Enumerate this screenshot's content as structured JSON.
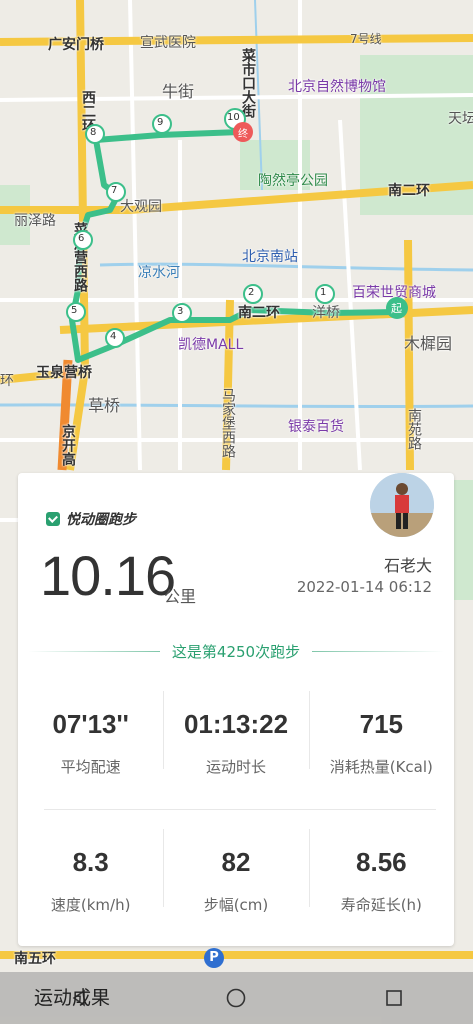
{
  "map": {
    "labels": {
      "guanganmen_bridge": "广安门桥",
      "xuanwu_hospital": "宣武医院",
      "line7": "7号线",
      "niujie": "牛街",
      "caishikou": "菜市口大街",
      "natural_museum": "北京自然博物馆",
      "tiantan": "天坛",
      "xierhuan": "西二环",
      "taoranting": "陶然亭公园",
      "nanerhuan": "南二环",
      "lizelu": "丽泽路",
      "daguanyuan": "大观园",
      "beijing_south": "北京南站",
      "liangshuihe": "凉水河",
      "bairong": "百荣世贸商城",
      "muxiyuan": "木樨园",
      "caihu_road": "菜户营西路",
      "kaide": "凯德MALL",
      "erhuan_road_label": "南二环",
      "yangqiao": "洋桥",
      "yuquanying": "玉泉营桥",
      "caoqiao": "草桥",
      "majiabao": "马家堡西路",
      "yintai": "银泰百货",
      "nanyuan": "南苑路",
      "jingkai": "京开高",
      "nanwuhuan": "南五环",
      "start": "起",
      "end": "终",
      "huan_left": "环"
    },
    "markers": [
      "1",
      "2",
      "3",
      "4",
      "5",
      "6",
      "7",
      "8",
      "9",
      "10"
    ],
    "route_color": "#3cbf8a"
  },
  "card": {
    "app_name": "悦动圈跑步",
    "distance": "10.16",
    "distance_unit": "公里",
    "user_name": "石老大",
    "datetime": "2022-01-14 06:12",
    "run_count_text": "这是第4250次跑步",
    "stats_row1": [
      {
        "value": "07'13''",
        "label": "平均配速"
      },
      {
        "value": "01:13:22",
        "label": "运动时长"
      },
      {
        "value": "715",
        "label": "消耗热量(Kcal)"
      }
    ],
    "stats_row2": [
      {
        "value": "8.3",
        "label": "速度(km/h)"
      },
      {
        "value": "82",
        "label": "步幅(cm)"
      },
      {
        "value": "8.56",
        "label": "寿命延长(h)"
      }
    ]
  },
  "bottom": {
    "label": "运动成果"
  },
  "navbar": {
    "icons": [
      "back-icon",
      "home-icon",
      "recents-icon"
    ]
  }
}
